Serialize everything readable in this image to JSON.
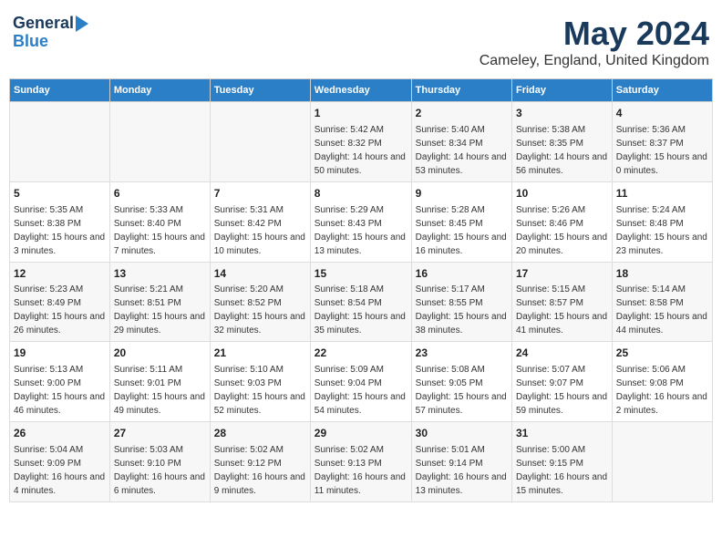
{
  "header": {
    "logo_general": "General",
    "logo_blue": "Blue",
    "month_title": "May 2024",
    "location": "Cameley, England, United Kingdom"
  },
  "days_of_week": [
    "Sunday",
    "Monday",
    "Tuesday",
    "Wednesday",
    "Thursday",
    "Friday",
    "Saturday"
  ],
  "weeks": [
    [
      {
        "day": "",
        "info": ""
      },
      {
        "day": "",
        "info": ""
      },
      {
        "day": "",
        "info": ""
      },
      {
        "day": "1",
        "info": "Sunrise: 5:42 AM\nSunset: 8:32 PM\nDaylight: 14 hours and 50 minutes."
      },
      {
        "day": "2",
        "info": "Sunrise: 5:40 AM\nSunset: 8:34 PM\nDaylight: 14 hours and 53 minutes."
      },
      {
        "day": "3",
        "info": "Sunrise: 5:38 AM\nSunset: 8:35 PM\nDaylight: 14 hours and 56 minutes."
      },
      {
        "day": "4",
        "info": "Sunrise: 5:36 AM\nSunset: 8:37 PM\nDaylight: 15 hours and 0 minutes."
      }
    ],
    [
      {
        "day": "5",
        "info": "Sunrise: 5:35 AM\nSunset: 8:38 PM\nDaylight: 15 hours and 3 minutes."
      },
      {
        "day": "6",
        "info": "Sunrise: 5:33 AM\nSunset: 8:40 PM\nDaylight: 15 hours and 7 minutes."
      },
      {
        "day": "7",
        "info": "Sunrise: 5:31 AM\nSunset: 8:42 PM\nDaylight: 15 hours and 10 minutes."
      },
      {
        "day": "8",
        "info": "Sunrise: 5:29 AM\nSunset: 8:43 PM\nDaylight: 15 hours and 13 minutes."
      },
      {
        "day": "9",
        "info": "Sunrise: 5:28 AM\nSunset: 8:45 PM\nDaylight: 15 hours and 16 minutes."
      },
      {
        "day": "10",
        "info": "Sunrise: 5:26 AM\nSunset: 8:46 PM\nDaylight: 15 hours and 20 minutes."
      },
      {
        "day": "11",
        "info": "Sunrise: 5:24 AM\nSunset: 8:48 PM\nDaylight: 15 hours and 23 minutes."
      }
    ],
    [
      {
        "day": "12",
        "info": "Sunrise: 5:23 AM\nSunset: 8:49 PM\nDaylight: 15 hours and 26 minutes."
      },
      {
        "day": "13",
        "info": "Sunrise: 5:21 AM\nSunset: 8:51 PM\nDaylight: 15 hours and 29 minutes."
      },
      {
        "day": "14",
        "info": "Sunrise: 5:20 AM\nSunset: 8:52 PM\nDaylight: 15 hours and 32 minutes."
      },
      {
        "day": "15",
        "info": "Sunrise: 5:18 AM\nSunset: 8:54 PM\nDaylight: 15 hours and 35 minutes."
      },
      {
        "day": "16",
        "info": "Sunrise: 5:17 AM\nSunset: 8:55 PM\nDaylight: 15 hours and 38 minutes."
      },
      {
        "day": "17",
        "info": "Sunrise: 5:15 AM\nSunset: 8:57 PM\nDaylight: 15 hours and 41 minutes."
      },
      {
        "day": "18",
        "info": "Sunrise: 5:14 AM\nSunset: 8:58 PM\nDaylight: 15 hours and 44 minutes."
      }
    ],
    [
      {
        "day": "19",
        "info": "Sunrise: 5:13 AM\nSunset: 9:00 PM\nDaylight: 15 hours and 46 minutes."
      },
      {
        "day": "20",
        "info": "Sunrise: 5:11 AM\nSunset: 9:01 PM\nDaylight: 15 hours and 49 minutes."
      },
      {
        "day": "21",
        "info": "Sunrise: 5:10 AM\nSunset: 9:03 PM\nDaylight: 15 hours and 52 minutes."
      },
      {
        "day": "22",
        "info": "Sunrise: 5:09 AM\nSunset: 9:04 PM\nDaylight: 15 hours and 54 minutes."
      },
      {
        "day": "23",
        "info": "Sunrise: 5:08 AM\nSunset: 9:05 PM\nDaylight: 15 hours and 57 minutes."
      },
      {
        "day": "24",
        "info": "Sunrise: 5:07 AM\nSunset: 9:07 PM\nDaylight: 15 hours and 59 minutes."
      },
      {
        "day": "25",
        "info": "Sunrise: 5:06 AM\nSunset: 9:08 PM\nDaylight: 16 hours and 2 minutes."
      }
    ],
    [
      {
        "day": "26",
        "info": "Sunrise: 5:04 AM\nSunset: 9:09 PM\nDaylight: 16 hours and 4 minutes."
      },
      {
        "day": "27",
        "info": "Sunrise: 5:03 AM\nSunset: 9:10 PM\nDaylight: 16 hours and 6 minutes."
      },
      {
        "day": "28",
        "info": "Sunrise: 5:02 AM\nSunset: 9:12 PM\nDaylight: 16 hours and 9 minutes."
      },
      {
        "day": "29",
        "info": "Sunrise: 5:02 AM\nSunset: 9:13 PM\nDaylight: 16 hours and 11 minutes."
      },
      {
        "day": "30",
        "info": "Sunrise: 5:01 AM\nSunset: 9:14 PM\nDaylight: 16 hours and 13 minutes."
      },
      {
        "day": "31",
        "info": "Sunrise: 5:00 AM\nSunset: 9:15 PM\nDaylight: 16 hours and 15 minutes."
      },
      {
        "day": "",
        "info": ""
      }
    ]
  ]
}
